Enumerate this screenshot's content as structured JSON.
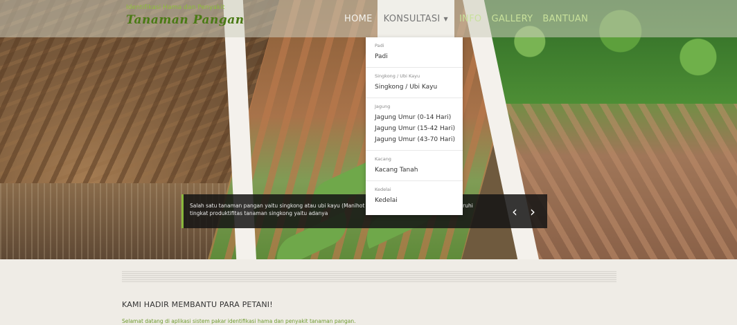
{
  "navbar": {
    "brand_top": "Identifikasi Hama dan Penyakit",
    "brand_main": "Tanaman Pangan",
    "items": [
      {
        "label": "HOME"
      },
      {
        "label": "KONSULTASI"
      },
      {
        "label": "INFO"
      },
      {
        "label": "GALLERY"
      },
      {
        "label": "BANTUAN"
      }
    ]
  },
  "dropdown": {
    "groups": [
      {
        "header": "Padi",
        "items": [
          "Padi"
        ]
      },
      {
        "header": "Singkong / Ubi Kayu",
        "items": [
          "Singkong / Ubi Kayu"
        ]
      },
      {
        "header": "Jagung",
        "items": [
          "Jagung Umur (0-14 Hari)",
          "Jagung Umur (15-42 Hari)",
          "Jagung Umur (43-70 Hari)"
        ]
      },
      {
        "header": "Kacang",
        "items": [
          "Kacang Tanah"
        ]
      },
      {
        "header": "Kedelai",
        "items": [
          "Kedelai"
        ]
      }
    ]
  },
  "slider": {
    "caption": "Salah satu tanaman pangan yaitu singkong atau ubi kayu (Manihot esculenta) ... faktor yang mempengaruhi tingkat produktifitas tanaman singkong yaitu adanya",
    "prev_icon": "chevron-left-icon",
    "next_icon": "chevron-right-icon"
  },
  "content": {
    "title": "KAMI HADIR MEMBANTU PARA PETANI!",
    "subtitle": "Selamat datang di aplikasi sistem pakar identifikasi hama dan penyakit tanaman pangan."
  },
  "colors": {
    "brand_green": "#4a7a14",
    "nav_link": "#c8e19b",
    "caption_accent": "#8ab83c"
  }
}
